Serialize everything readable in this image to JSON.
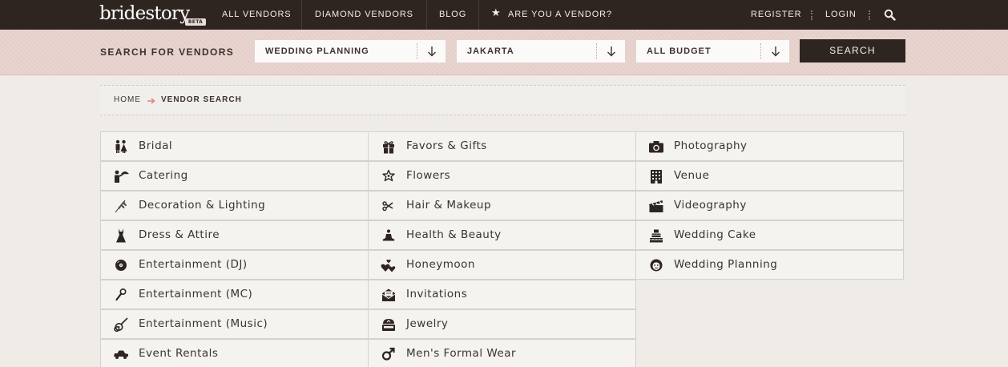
{
  "header": {
    "logo_text": "bridestory",
    "logo_badge": "BETA",
    "nav": {
      "all_vendors": "ALL VENDORS",
      "diamond_vendors": "DIAMOND VENDORS",
      "blog": "BLOG",
      "are_you_vendor": "ARE YOU A VENDOR?",
      "register": "REGISTER",
      "login": "LOGIN"
    }
  },
  "search": {
    "label": "SEARCH FOR VENDORS",
    "category": "WEDDING PLANNING",
    "location": "JAKARTA",
    "budget": "ALL BUDGET",
    "button": "SEARCH"
  },
  "breadcrumb": {
    "home": "HOME",
    "current": "VENDOR SEARCH"
  },
  "categories": {
    "col1": [
      "Bridal",
      "Catering",
      "Decoration & Lighting",
      "Dress & Attire",
      "Entertainment (DJ)",
      "Entertainment (MC)",
      "Entertainment (Music)",
      "Event Rentals"
    ],
    "col2": [
      "Favors & Gifts",
      "Flowers",
      "Hair & Makeup",
      "Health & Beauty",
      "Honeymoon",
      "Invitations",
      "Jewelry",
      "Men's Formal Wear"
    ],
    "col3": [
      "Photography",
      "Venue",
      "Videography",
      "Wedding Cake",
      "Wedding Planning"
    ]
  },
  "icons": {
    "col1": [
      "couple-icon",
      "waiter-icon",
      "wheat-icon",
      "dress-icon",
      "vinyl-record-icon",
      "microphone-icon",
      "guitar-icon",
      "car-icon"
    ],
    "col2": [
      "gift-icon",
      "flower-icon",
      "scissors-icon",
      "meditation-icon",
      "hearts-icon",
      "envelope-icon",
      "ring-box-icon",
      "male-symbol-icon"
    ],
    "col3": [
      "camera-icon",
      "building-icon",
      "clapperboard-icon",
      "cake-icon",
      "planner-icon"
    ]
  },
  "colors": {
    "topbar": "#2e2521",
    "searchbar": "#e9d2cd",
    "accent_arrow": "#e08a84"
  }
}
